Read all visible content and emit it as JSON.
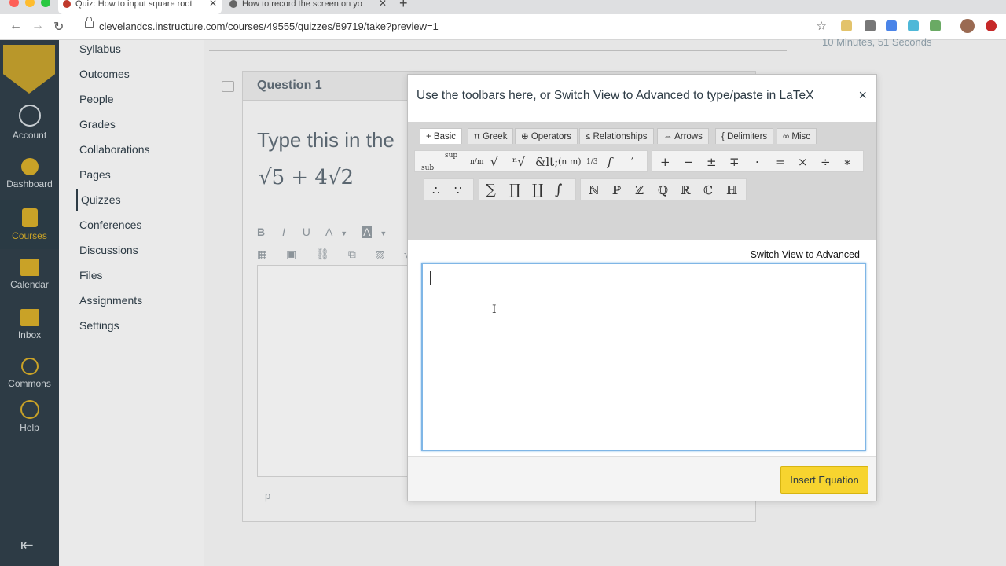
{
  "browser": {
    "tabs": [
      {
        "title": "Quiz: How to input square root",
        "active": true
      },
      {
        "title": "How to record the screen on yo",
        "active": false
      }
    ],
    "url": "clevelandcs.instructure.com/courses/49555/quizzes/89719/take?preview=1"
  },
  "global_nav": [
    {
      "label": "Account",
      "icon": "user-icon"
    },
    {
      "label": "Dashboard",
      "icon": "speedometer-icon"
    },
    {
      "label": "Courses",
      "icon": "book-icon",
      "active": true
    },
    {
      "label": "Calendar",
      "icon": "calendar-icon"
    },
    {
      "label": "Inbox",
      "icon": "envelope-icon"
    },
    {
      "label": "Commons",
      "icon": "commons-icon"
    },
    {
      "label": "Help",
      "icon": "help-icon"
    }
  ],
  "course_nav": [
    "Syllabus",
    "Outcomes",
    "People",
    "Grades",
    "Collaborations",
    "Pages",
    "Quizzes",
    "Conferences",
    "Discussions",
    "Files",
    "Assignments",
    "Settings"
  ],
  "course_nav_active": "Quizzes",
  "timer": "10 Minutes, 51 Seconds",
  "question": {
    "title": "Question 1",
    "text": "Type this in the",
    "math": "√5 + 4√2",
    "rce_path": "p"
  },
  "modal": {
    "title": "Use the toolbars here, or Switch View to Advanced to type/paste in LaTeX",
    "close": "×",
    "tabs": [
      {
        "icon": "+",
        "label": "Basic"
      },
      {
        "icon": "π",
        "label": "Greek"
      },
      {
        "icon": "⊕",
        "label": "Operators"
      },
      {
        "icon": "≤",
        "label": "Relationships"
      },
      {
        "icon": "⇔",
        "label": "Arrows"
      },
      {
        "icon": "{",
        "label": "Delimiters"
      },
      {
        "icon": "∞",
        "label": "Misc"
      }
    ],
    "row1_a": [
      "sub",
      "sup",
      "n/m",
      "√",
      "ⁿ√",
      "&lt;",
      "(n m)",
      "1/3",
      "f",
      "′"
    ],
    "row1_b": [
      "+",
      "−",
      "±",
      "∓",
      "·",
      "=",
      "×",
      "÷",
      "∗"
    ],
    "row2_a": [
      "∴",
      "∵"
    ],
    "row2_b": [
      "∑",
      "∏",
      "∐",
      "∫"
    ],
    "row2_c": [
      "ℕ",
      "ℙ",
      "ℤ",
      "ℚ",
      "ℝ",
      "ℂ",
      "ℍ"
    ],
    "switch_view": "Switch View to Advanced",
    "insert_button": "Insert Equation"
  },
  "colors": {
    "canvas_nav": "#2d3b45",
    "accent_yellow": "#f7d42f",
    "editor_focus": "#7fb6e6"
  }
}
